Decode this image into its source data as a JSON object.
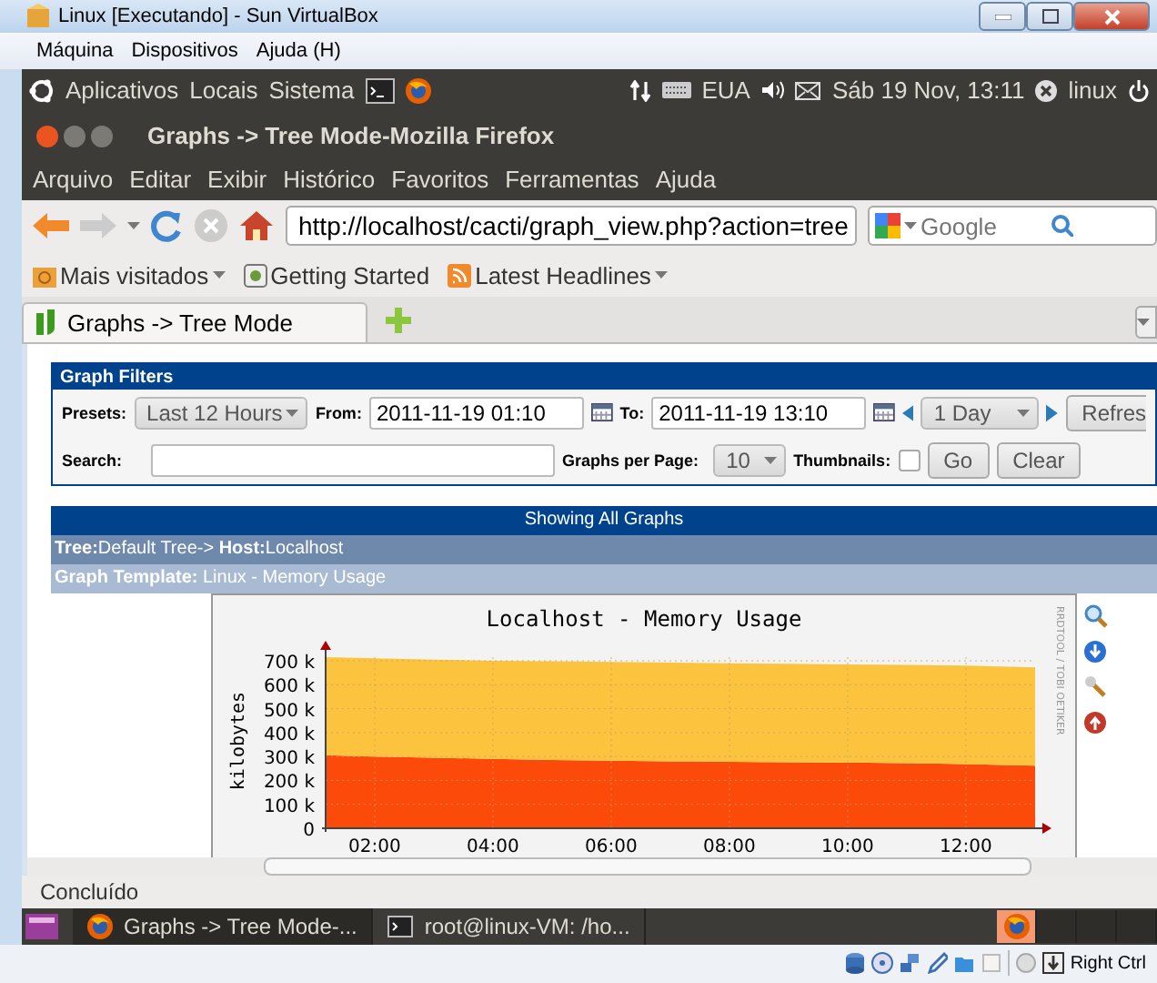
{
  "vbox_window": {
    "title": "Linux [Executando] - Sun VirtualBox",
    "menu": [
      "Máquina",
      "Dispositivos",
      "Ajuda (H)"
    ]
  },
  "top_panel": {
    "menus": [
      "Aplicativos",
      "Locais",
      "Sistema"
    ],
    "keyboard": "EUA",
    "clock": "Sáb 19 Nov, 13:11",
    "user": "linux"
  },
  "firefox": {
    "title": "Graphs -> Tree Mode-Mozilla Firefox",
    "menu": [
      "Arquivo",
      "Editar",
      "Exibir",
      "Histórico",
      "Favoritos",
      "Ferramentas",
      "Ajuda"
    ],
    "url": "http://localhost/cacti/graph_view.php?action=tree",
    "search": {
      "placeholder": "Google"
    },
    "bookmarks": [
      {
        "label": "Mais visitados",
        "dropdown": true
      },
      {
        "label": "Getting Started",
        "dropdown": false
      },
      {
        "label": "Latest Headlines",
        "dropdown": true
      }
    ],
    "tabs": [
      {
        "label": "Graphs -> Tree Mode",
        "selected": true
      }
    ],
    "status": "Concluído"
  },
  "graph_filters": {
    "title": "Graph Filters",
    "presets_label": "Presets:",
    "preset": "Last 12 Hours",
    "from_label": "From:",
    "from": "2011-11-19 01:10",
    "to_label": "To:",
    "to": "2011-11-19 13:10",
    "span": "1 Day",
    "refresh_button": "Refres",
    "search_label": "Search:",
    "per_page_label": "Graphs per Page:",
    "per_page": "10",
    "thumbnails_label": "Thumbnails:",
    "thumbnails": false,
    "buttons": [
      "Go",
      "Clear"
    ]
  },
  "graphs": {
    "header": "Showing All Graphs",
    "tree_path": "**Tree:**Default Tree-> **Host:**Localhost",
    "template": "**Graph Template:** Linux - Memory Usage",
    "graph": {
      "credit": "RRDTOOL / TOBI OETIKER",
      "chart_data": {
        "type": "area",
        "stacked": true,
        "title": "Localhost - Memory Usage",
        "ylabel": "kilobytes",
        "x": [
          1.17,
          2,
          3,
          4,
          5,
          6,
          7,
          8,
          9,
          10,
          11,
          12,
          13.17
        ],
        "series": [
          {
            "color": "#fc4a0a",
            "values": [
              305000,
              300000,
              295000,
              290000,
              285000,
              282000,
              280000,
              278000,
              276000,
              275000,
              272000,
              268000,
              262000
            ]
          },
          {
            "color": "#fcc43e",
            "values": [
              410000,
              410000,
              410000,
              410000,
              413000,
              413000,
              412000,
              412000,
              412000,
              410000,
              411000,
              412000,
              410000
            ]
          }
        ],
        "xlim": [
          1.17,
          13.17
        ],
        "ylim": [
          0,
          730000
        ],
        "grid": true,
        "xticks": [
          {
            "value": 2,
            "label": "02:00"
          },
          {
            "value": 4,
            "label": "04:00"
          },
          {
            "value": 6,
            "label": "06:00"
          },
          {
            "value": 8,
            "label": "08:00"
          },
          {
            "value": 10,
            "label": "10:00"
          },
          {
            "value": 12,
            "label": "12:00"
          }
        ],
        "yticks": [
          {
            "value": 0,
            "label": "0"
          },
          {
            "value": 100000,
            "label": "100 k"
          },
          {
            "value": 200000,
            "label": "200 k"
          },
          {
            "value": 300000,
            "label": "300 k"
          },
          {
            "value": 400000,
            "label": "400 k"
          },
          {
            "value": 500000,
            "label": "500 k"
          },
          {
            "value": 600000,
            "label": "600 k"
          },
          {
            "value": 700000,
            "label": "700 k"
          }
        ]
      }
    }
  },
  "taskbar": {
    "windows": [
      {
        "label": "Graphs -> Tree Mode-...",
        "kind": "browser",
        "selected": true
      },
      {
        "label": "root@linux-VM: /ho...",
        "kind": "terminal",
        "selected": false
      }
    ],
    "workspaces": [
      {
        "selected": true
      },
      {
        "selected": false
      },
      {
        "selected": false
      },
      {
        "selected": false
      }
    ]
  },
  "vbox_status": {
    "host_key": "Right Ctrl"
  }
}
